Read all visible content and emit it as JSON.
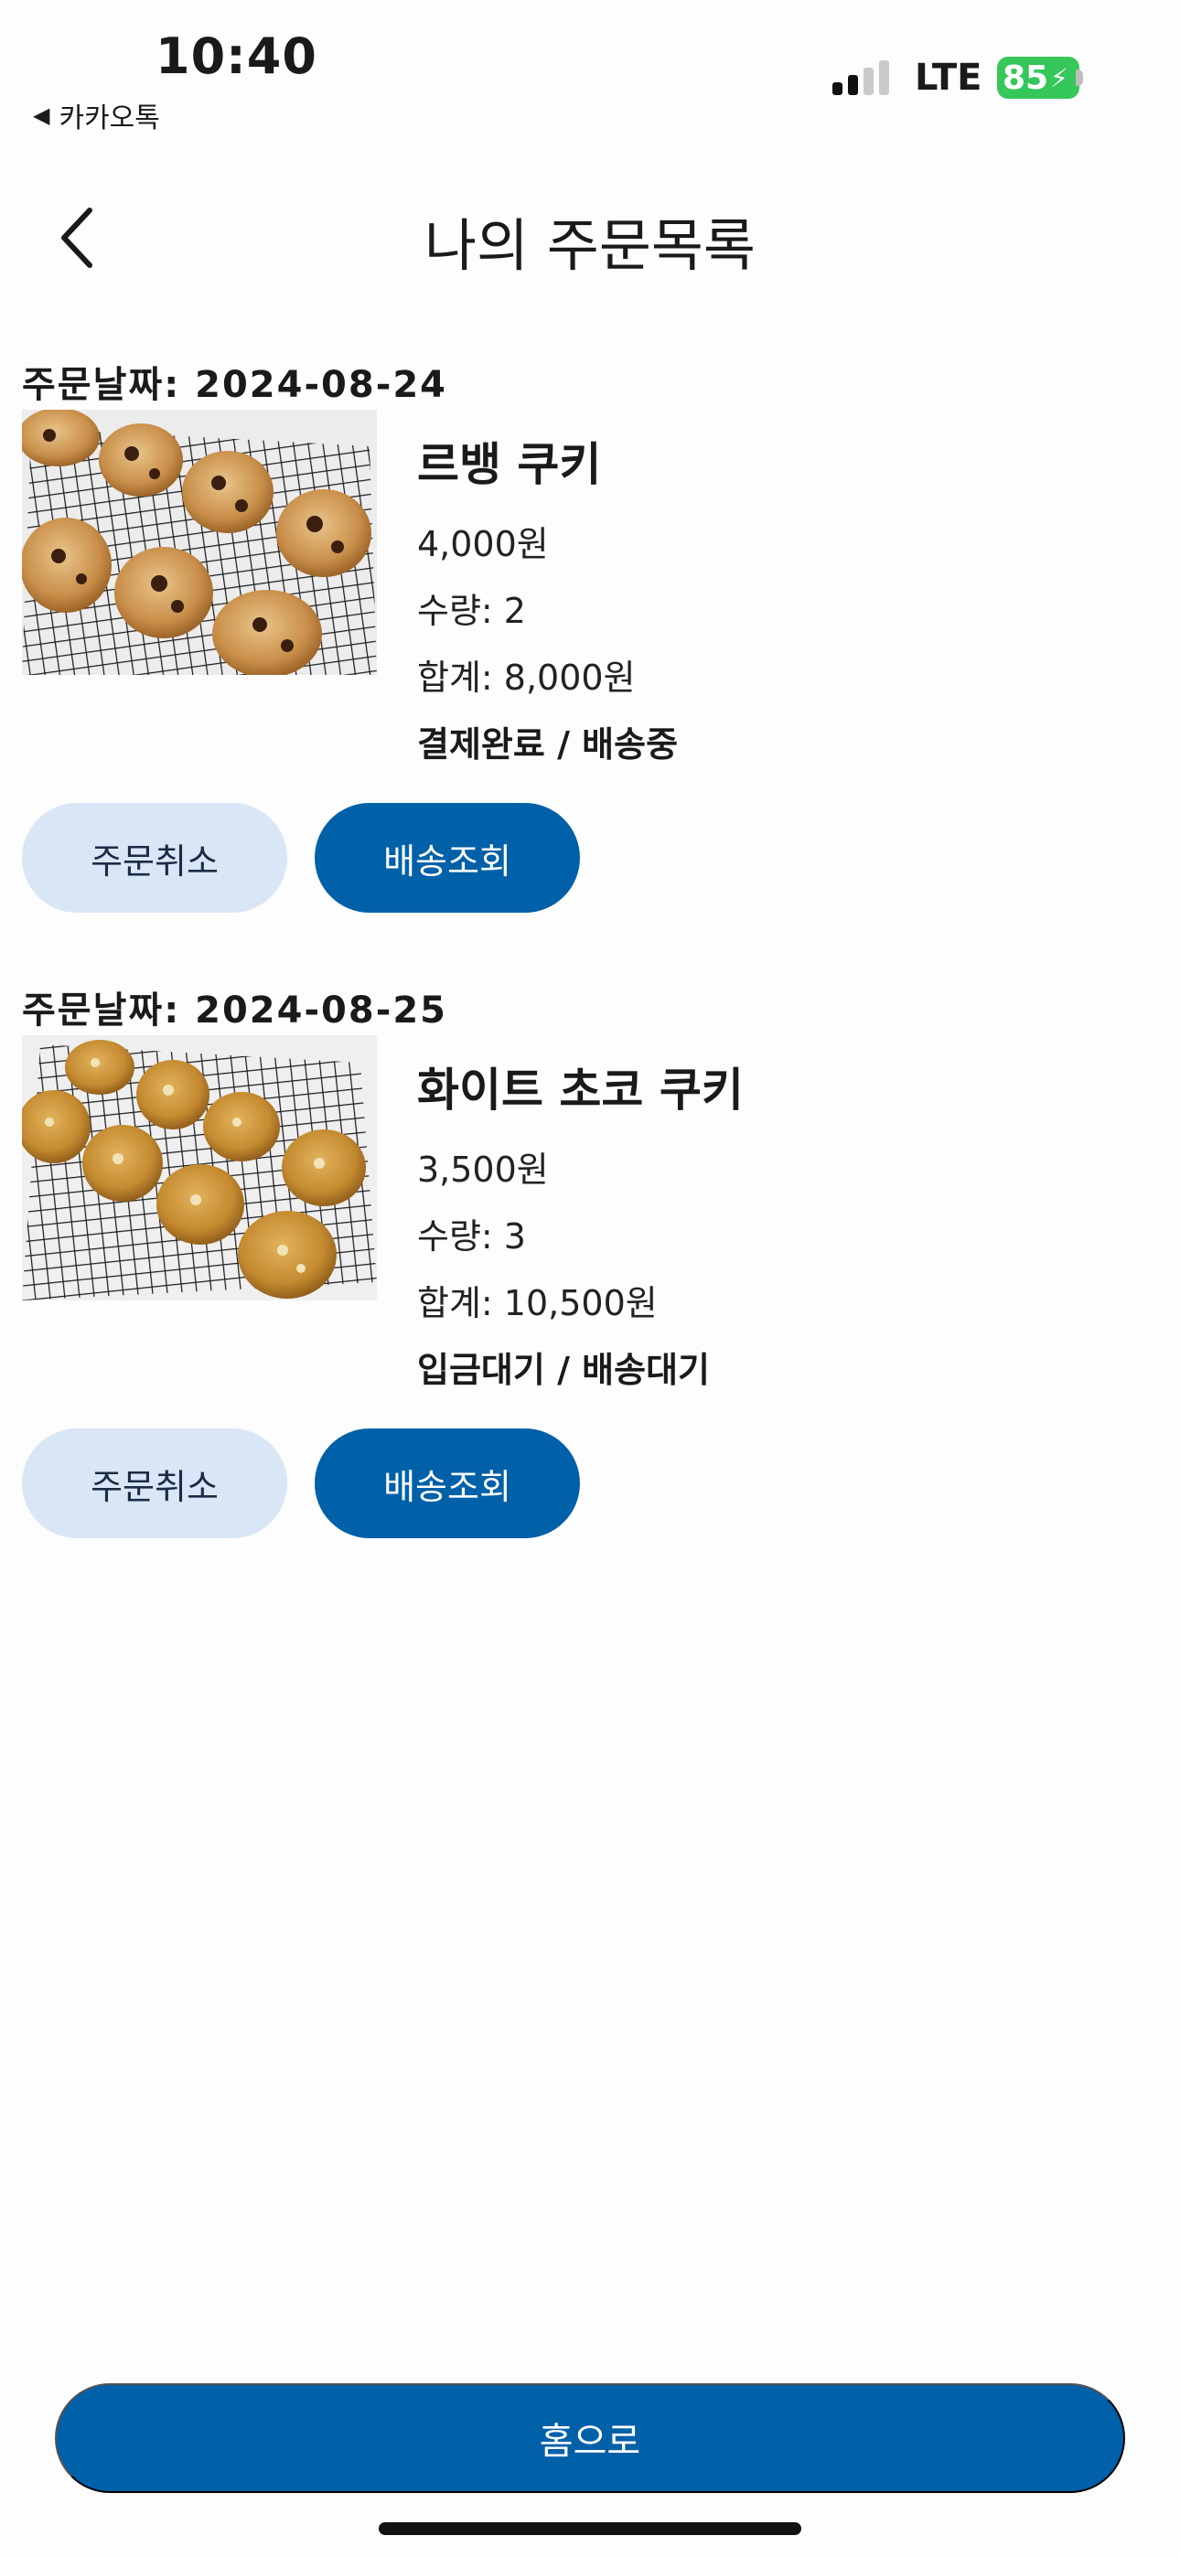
{
  "status_bar": {
    "time": "10:40",
    "back_app": "카카오톡",
    "network": "LTE",
    "battery": "85"
  },
  "header": {
    "title": "나의 주문목록",
    "back_icon": "chevron-left-icon"
  },
  "orders": [
    {
      "date_label": "주문날짜: 2024-08-24",
      "product_name": "르뱅 쿠키",
      "price": "4,000원",
      "quantity": "수량: 2",
      "total": "합계: 8,000원",
      "status": "결제완료 / 배송중",
      "cancel_label": "주문취소",
      "track_label": "배송조회"
    },
    {
      "date_label": "주문날짜: 2024-08-25",
      "product_name": "화이트 초코 쿠키",
      "price": "3,500원",
      "quantity": "수량: 3",
      "total": "합계: 10,500원",
      "status": "입금대기 / 배송대기",
      "cancel_label": "주문취소",
      "track_label": "배송조회"
    }
  ],
  "footer": {
    "home_label": "홈으로"
  },
  "colors": {
    "primary": "#0060a8",
    "secondary": "#d9e6f5",
    "battery": "#35c759"
  }
}
